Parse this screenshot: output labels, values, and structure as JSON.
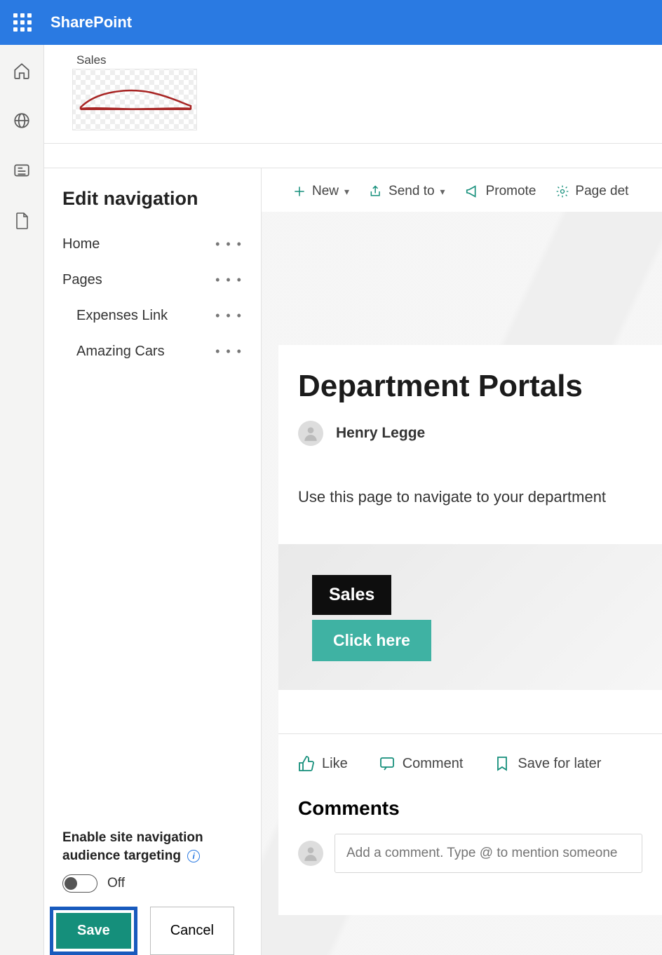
{
  "suite": {
    "app_name": "SharePoint"
  },
  "site": {
    "label": "Sales"
  },
  "nav": {
    "title": "Edit navigation",
    "items": [
      {
        "label": "Home",
        "sub": false
      },
      {
        "label": "Pages",
        "sub": false
      },
      {
        "label": "Expenses Link",
        "sub": true
      },
      {
        "label": "Amazing Cars",
        "sub": true
      }
    ],
    "toggle_label_line1": "Enable site navigation",
    "toggle_label_line2": "audience targeting",
    "toggle_state": "Off",
    "save": "Save",
    "cancel": "Cancel"
  },
  "cmd": {
    "new": "New",
    "send": "Send to",
    "promote": "Promote",
    "details": "Page det"
  },
  "page": {
    "title": "Department Portals",
    "author": "Henry Legge",
    "desc": "Use this page to navigate to your department",
    "hero_tag": "Sales",
    "hero_btn": "Click here"
  },
  "social": {
    "like": "Like",
    "comment": "Comment",
    "save": "Save for later"
  },
  "comments": {
    "title": "Comments",
    "placeholder": "Add a comment. Type @ to mention someone"
  }
}
